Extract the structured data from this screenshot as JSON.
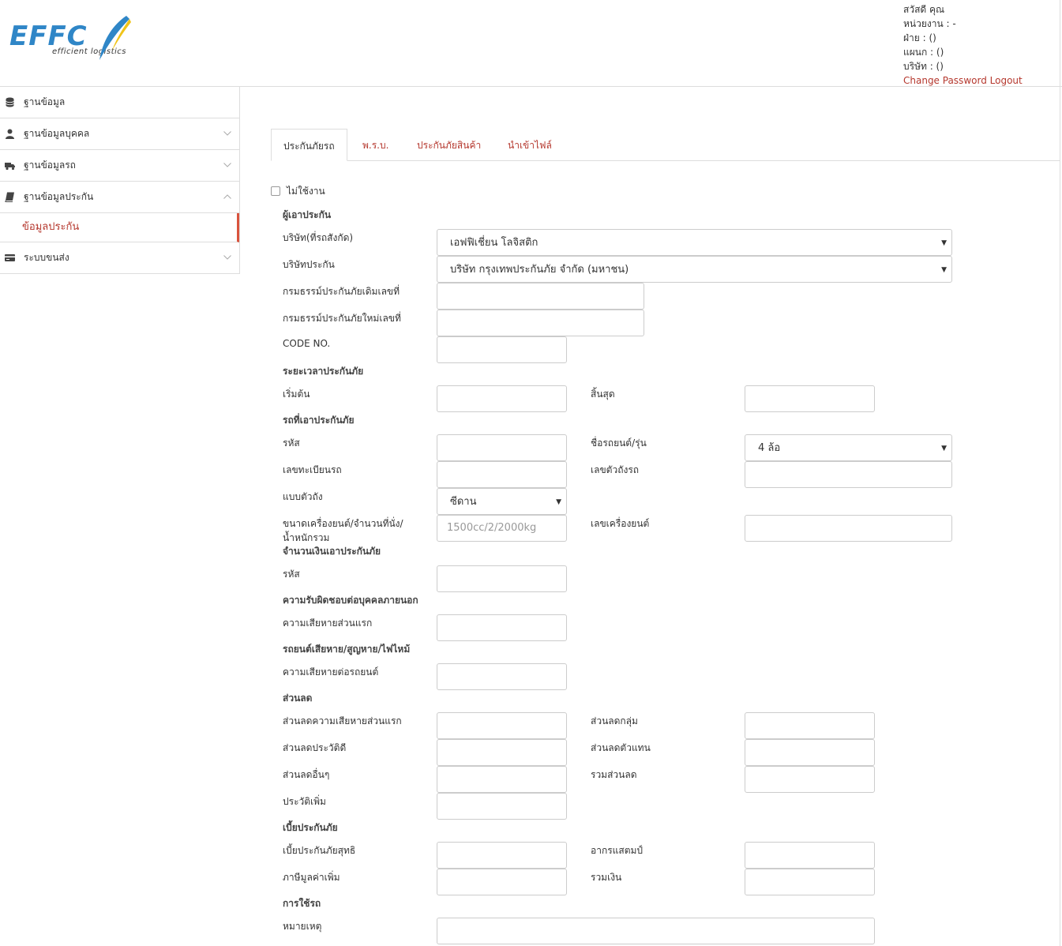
{
  "header": {
    "logo_text": "EFFC",
    "logo_subtitle": "efficient logistics",
    "greeting": "สวัสดี คุณ",
    "unit": "หน่วยงาน : -",
    "department": "ฝ่าย : ()",
    "section": "แผนก : ()",
    "company": "บริษัท : ()",
    "change_password": "Change Password",
    "logout": "Logout"
  },
  "sidebar": {
    "items": [
      {
        "label": "ฐานข้อมูล",
        "icon": "database-icon"
      },
      {
        "label": "ฐานข้อมูลบุคคล",
        "icon": "user-icon"
      },
      {
        "label": "ฐานข้อมูลรถ",
        "icon": "truck-icon"
      },
      {
        "label": "ฐานข้อมูลประกัน",
        "icon": "book-icon"
      },
      {
        "label": "ระบบขนส่ง",
        "icon": "card-icon"
      }
    ],
    "sub_item": "ข้อมูลประกัน"
  },
  "tabs": [
    "ประกันภัยรถ",
    "พ.ร.บ.",
    "ประกันภัยสินค้า",
    "นำเข้าไฟล์"
  ],
  "form": {
    "inactive_label": "ไม่ใช้งาน",
    "sections": {
      "insured": "ผู้เอาประกัน",
      "period": "ระยะเวลาประกันภัย",
      "vehicle": "รถที่เอาประกันภัย",
      "sum_insured": "จำนวนเงินเอาประกันภัย",
      "third_party": "ความรับผิดชอบต่อบุคคลภายนอก",
      "damage": "รถยนต์เสียหาย/สูญหาย/ไฟไหม้",
      "discount": "ส่วนลด",
      "premium": "เบี้ยประกันภัย",
      "usage": "การใช้รถ"
    },
    "labels": {
      "company": "บริษัท(ที่รถสังกัด)",
      "insurer": "บริษัทประกัน",
      "old_policy": "กรมธรรม์ประกันภัยเดิมเลขที่",
      "new_policy": "กรมธรรม์ประกันภัยใหม่เลขที่",
      "code_no": "CODE NO.",
      "start": "เริ่มต้น",
      "end": "สิ้นสุด",
      "vehicle_code": "รหัส",
      "car_model": "ชื่อรถยนต์/รุ่น",
      "plate": "เลขทะเบียนรถ",
      "chassis": "เลขตัวถังรถ",
      "body_type": "แบบตัวถัง",
      "engine_size_line1": "ขนาดเครื่องยนต์/จำนวนที่นั่ง/",
      "engine_size_line2": "น้ำหนักรวม",
      "engine_no": "เลขเครื่องยนต์",
      "sum_code": "รหัส",
      "first_damage": "ความเสียหายส่วนแรก",
      "damage_per_car": "ความเสียหายต่อรถยนต์",
      "disc_first_damage": "ส่วนลดความเสียหายส่วนแรก",
      "disc_group": "ส่วนลดกลุ่ม",
      "disc_history": "ส่วนลดประวัติดี",
      "disc_agent": "ส่วนลดตัวแทน",
      "disc_other": "ส่วนลดอื่นๆ",
      "disc_total": "รวมส่วนลด",
      "history_add": "ประวัติเพิ่ม",
      "net_premium": "เบี้ยประกันภัยสุทธิ",
      "stamp_duty": "อากรแสตมป์",
      "vat": "ภาษีมูลค่าเพิ่ม",
      "total": "รวมเงิน",
      "remark": "หมายเหตุ"
    },
    "values": {
      "company": "เอฟฟิเชี่ยน โลจิสติก",
      "insurer": "บริษัท กรุงเทพประกันภัย จำกัด (มหาชน)",
      "car_model": "4 ล้อ",
      "body_type": "ซีดาน",
      "engine_size_placeholder": "1500cc/2/2000kg"
    }
  }
}
